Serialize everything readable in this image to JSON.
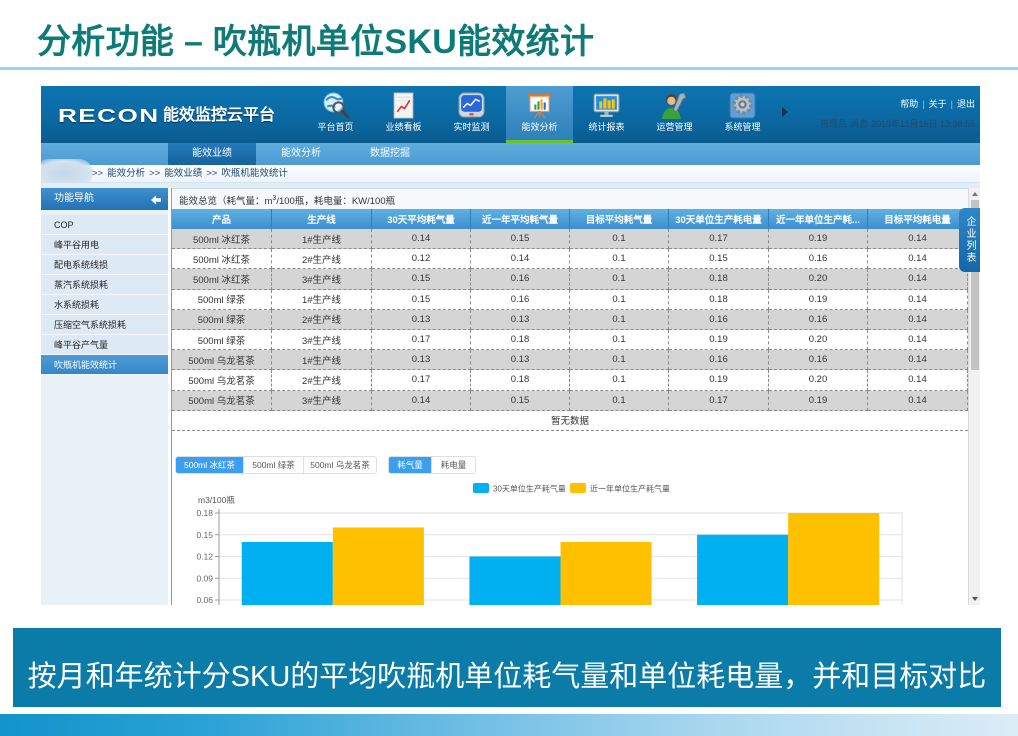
{
  "slide": {
    "title": "分析功能 – 吹瓶机单位SKU能效统计",
    "caption": "按月和年统计分SKU的平均吹瓶机单位耗气量和单位耗电量，并和目标对比"
  },
  "app": {
    "logo_brand": "RECON",
    "logo_name": "能效监控云平台",
    "nav": [
      {
        "label": "平台首页",
        "icon": "globe-search-icon"
      },
      {
        "label": "业绩看板",
        "icon": "chart-document-icon"
      },
      {
        "label": "实时监测",
        "icon": "monitor-chart-icon"
      },
      {
        "label": "能效分析",
        "icon": "presentation-chart-icon",
        "active": true
      },
      {
        "label": "统计报表",
        "icon": "monitor-bars-icon"
      },
      {
        "label": "运营管理",
        "icon": "user-wrench-icon"
      },
      {
        "label": "系统管理",
        "icon": "gear-icon"
      }
    ],
    "top_links": [
      "帮助",
      "关于",
      "退出"
    ],
    "top_link_separator": "|",
    "status": {
      "user": "管理员",
      "messages": "消息",
      "datetime": "2019年11月16日 13:38:55"
    }
  },
  "subnav": [
    {
      "label": "能效业绩",
      "active": true
    },
    {
      "label": "能效分析"
    },
    {
      "label": "数据挖掘"
    }
  ],
  "breadcrumb": {
    "separator": ">>",
    "items": [
      "能效分析",
      "能效业绩",
      "吹瓶机能效统计"
    ]
  },
  "sidebar": {
    "title": "功能导航",
    "collapse_icon": "arrow-left-icon",
    "items": [
      {
        "label": "COP"
      },
      {
        "label": "峰平谷用电"
      },
      {
        "label": "配电系统线损"
      },
      {
        "label": "蒸汽系统损耗"
      },
      {
        "label": "水系统损耗"
      },
      {
        "label": "压缩空气系统损耗"
      },
      {
        "label": "峰平谷产气量"
      },
      {
        "label": "吹瓶机能效统计",
        "active": true
      }
    ]
  },
  "overview": {
    "title_prefix": "能效总览（耗气量：m",
    "title_sup": "3",
    "title_suffix": "/100瓶，耗电量：KW/100瓶"
  },
  "table": {
    "columns": [
      "产品",
      "生产线",
      "30天平均耗气量",
      "近一年平均耗气量",
      "目标平均耗气量",
      "30天单位生产耗电量",
      "近一年单位生产耗...",
      "目标平均耗电量"
    ],
    "rows": [
      [
        "500ml 冰红茶",
        "1#生产线",
        "0.14",
        "0.15",
        "0.1",
        "0.17",
        "0.19",
        "0.14"
      ],
      [
        "500ml 冰红茶",
        "2#生产线",
        "0.12",
        "0.14",
        "0.1",
        "0.15",
        "0.16",
        "0.14"
      ],
      [
        "500ml 冰红茶",
        "3#生产线",
        "0.15",
        "0.16",
        "0.1",
        "0.18",
        "0.20",
        "0.14"
      ],
      [
        "500ml 绿茶",
        "1#生产线",
        "0.15",
        "0.16",
        "0.1",
        "0.18",
        "0.19",
        "0.14"
      ],
      [
        "500ml 绿茶",
        "2#生产线",
        "0.13",
        "0.13",
        "0.1",
        "0.16",
        "0.16",
        "0.14"
      ],
      [
        "500ml 绿茶",
        "3#生产线",
        "0.17",
        "0.18",
        "0.1",
        "0.19",
        "0.20",
        "0.14"
      ],
      [
        "500ml 乌龙茗茶",
        "1#生产线",
        "0.13",
        "0.13",
        "0.1",
        "0.16",
        "0.16",
        "0.14"
      ],
      [
        "500ml 乌龙茗茶",
        "2#生产线",
        "0.17",
        "0.18",
        "0.1",
        "0.19",
        "0.20",
        "0.14"
      ],
      [
        "500ml 乌龙茗茶",
        "3#生产线",
        "0.14",
        "0.15",
        "0.1",
        "0.17",
        "0.19",
        "0.14"
      ]
    ],
    "empty_text": "暂无数据"
  },
  "chart_controls": {
    "products": [
      "500ml 冰红茶",
      "500ml 绿茶",
      "500ml 乌龙茗茶"
    ],
    "active_product": 0,
    "metrics": [
      "耗气量",
      "耗电量"
    ],
    "active_metric": 0
  },
  "side_tab": "企业列表",
  "colors": {
    "title": "#0e7b78",
    "header_bg": "#0b69a3",
    "active_nav_underline": "#6cc12e",
    "banner_bg": "#0b7ca8",
    "table_header": "#4a9fd6",
    "button_active": "#3c9ef0"
  },
  "chart_data": {
    "type": "bar",
    "title": "",
    "xlabel": "",
    "ylabel": "m3/100瓶",
    "categories": [],
    "series": [
      {
        "name": "30天单位生产耗气量",
        "values": [
          0.14,
          0.12,
          0.15
        ]
      },
      {
        "name": "近一年单位生产耗气量",
        "values": [
          0.16,
          0.14,
          0.18
        ]
      }
    ],
    "colors": [
      "#00b0f0",
      "#ffc000"
    ],
    "ylim": [
      0,
      0.18
    ],
    "yticks": [
      0.18,
      0.15,
      0.12,
      0.09,
      0.06
    ],
    "ytick_labels": [
      "0.18",
      "0.15",
      "0.12",
      "0.09",
      "0.06"
    ],
    "grid": true,
    "legend": "top-center"
  }
}
